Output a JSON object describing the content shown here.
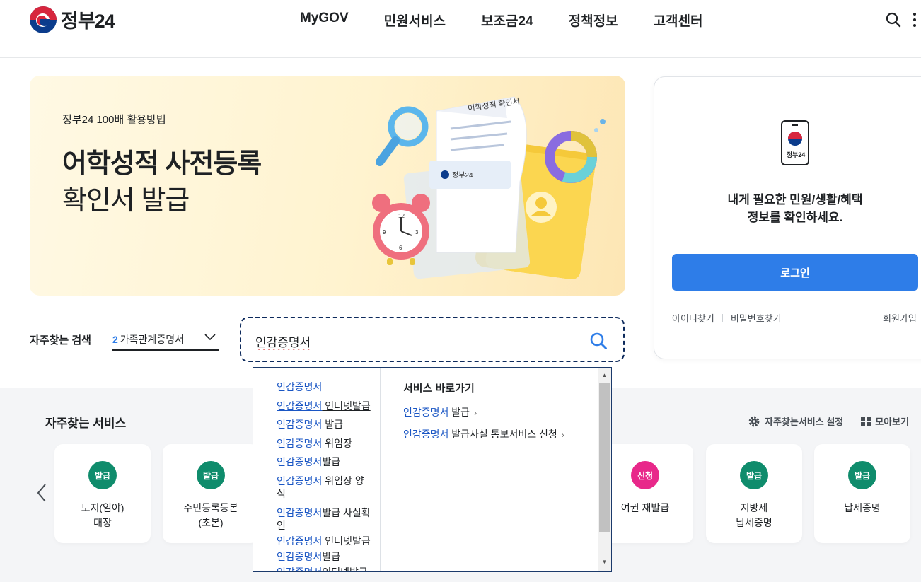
{
  "header": {
    "logo_text": "정부24",
    "nav": [
      "MyGOV",
      "민원서비스",
      "보조금24",
      "정책정보",
      "고객센터"
    ],
    "search_icon": "search-icon",
    "more_icon": "more-vertical-icon"
  },
  "banner": {
    "subtitle": "정부24 100배 활용방법",
    "title": "어학성적 사전등록",
    "title2": "확인서 발급",
    "illustration_doc_title": "어학성적 확인서",
    "illustration_stamp": "정부24"
  },
  "login": {
    "phone_label": "정부24",
    "desc_line1": "내게 필요한 민원/생활/혜택",
    "desc_line2": "정보를 확인하세요.",
    "button": "로그인",
    "find_id": "아이디찾기",
    "find_pw": "비밀번호찾기",
    "join": "회원가입"
  },
  "search": {
    "freq_label": "자주찾는 검색",
    "freq_num": "2",
    "freq_value": "가족관계증명서",
    "query": "인감증명서"
  },
  "autocomplete": {
    "suggestions": [
      {
        "hl": "인감증명서",
        "rest": ""
      },
      {
        "hl": "인감증명서",
        "rest": " 인터넷발급"
      },
      {
        "hl": "인감증명서",
        "rest": " 발급"
      },
      {
        "hl": "인감증명서",
        "rest": " 위임장"
      },
      {
        "hl": "인감증명서",
        "rest": "발급"
      },
      {
        "hl": "인감증명서",
        "rest": " 위임장 양식"
      },
      {
        "hl": "인감증명서",
        "rest": "발급 사실확"
      },
      {
        "hl": "",
        "rest": "인"
      },
      {
        "hl": "인감증명서",
        "rest": " 인터넷발급"
      },
      {
        "hl": "인감증명서",
        "rest": "발급"
      },
      {
        "hl": "인감증명서",
        "rest": "인터넷발급"
      }
    ],
    "shortcut_title": "서비스 바로가기",
    "shortcuts": [
      {
        "hl": "인감증명서",
        "rest": " 발급",
        "arrow": "›"
      },
      {
        "hl": "인감증명서",
        "rest": " 발급사실 통보서비스 신청",
        "arrow": "›"
      }
    ]
  },
  "services": {
    "title": "자주찾는 서비스",
    "settings": "자주찾는서비스 설정",
    "view_all": "모아보기",
    "cards": [
      {
        "badge": "발급",
        "color": "green",
        "line1": "토지(임야)",
        "line2": "대장"
      },
      {
        "badge": "발급",
        "color": "green",
        "line1": "주민등록등본",
        "line2": "(초본)"
      },
      {
        "badge": "신청",
        "color": "pink",
        "line1": "여권 재발급",
        "line2": ""
      },
      {
        "badge": "발급",
        "color": "green",
        "line1": "지방세",
        "line2": "납세증명"
      },
      {
        "badge": "발급",
        "color": "green",
        "line1": "납세증명",
        "line2": ""
      }
    ]
  },
  "colors": {
    "primary": "#2e7de8",
    "navy": "#0b3c8c",
    "red": "#d7263d",
    "badge_green": "#0f8c6c",
    "badge_pink": "#e8288a"
  }
}
